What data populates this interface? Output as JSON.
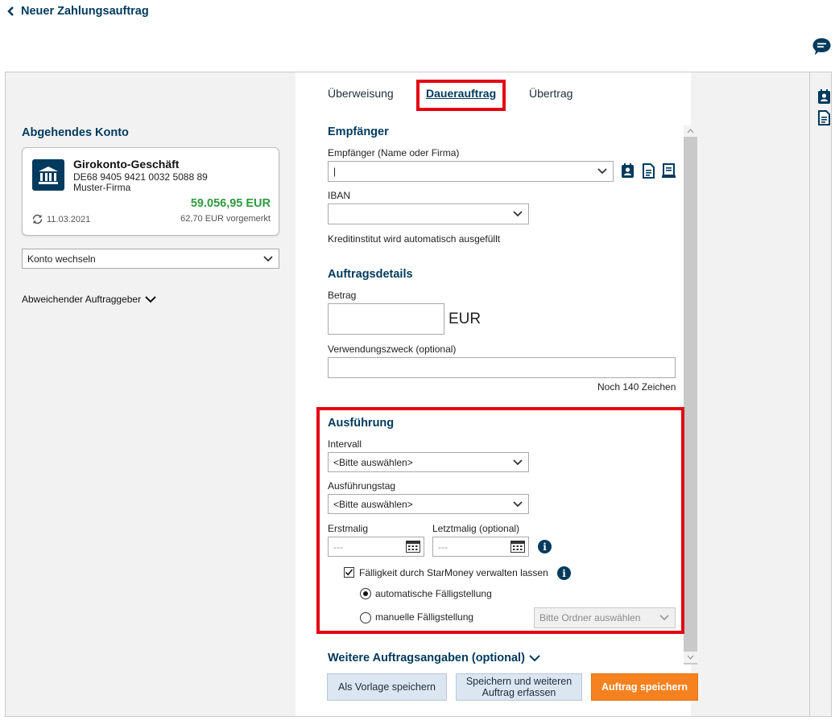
{
  "header": {
    "back_label": "Neuer Zahlungsauftrag"
  },
  "account": {
    "section_title": "Abgehendes Konto",
    "name": "Girokonto-Geschäft",
    "iban": "DE68 9405 9421 0032 5088 89",
    "holder": "Muster-Firma",
    "balance": "59.056,95 EUR",
    "date": "11.03.2021",
    "pending": "62,70 EUR vorgemerkt",
    "switch_label": "Konto wechseln",
    "other_payer_label": "Abweichender Auftraggeber"
  },
  "tabs": [
    "Überweisung",
    "Dauerauftrag",
    "Übertrag"
  ],
  "recipient": {
    "title": "Empfänger",
    "name_label": "Empfänger (Name oder Firma)",
    "name_value": "|",
    "iban_label": "IBAN",
    "bank_note": "Kreditinstitut wird automatisch ausgefüllt"
  },
  "details": {
    "title": "Auftragsdetails",
    "amount_label": "Betrag",
    "currency": "EUR",
    "purpose_label": "Verwendungszweck (optional)",
    "remaining": "Noch 140 Zeichen"
  },
  "execution": {
    "title": "Ausführung",
    "interval_label": "Intervall",
    "interval_value": "<Bitte auswählen>",
    "day_label": "Ausführungstag",
    "day_value": "<Bitte auswählen>",
    "first_label": "Erstmalig",
    "first_value": "---",
    "last_label": "Letztmalig (optional)",
    "last_value": "---",
    "manage_label": "Fälligkeit durch StarMoney verwalten lassen",
    "manage_checked": true,
    "auto_label": "automatische Fälligstellung",
    "manual_label": "manuelle Fälligstellung",
    "folder_placeholder": "Bitte Ordner auswählen"
  },
  "more": {
    "label": "Weitere Auftragsangaben (optional)"
  },
  "buttons": {
    "template": "Als Vorlage speichern",
    "save_more_line1": "Speichern und weiteren",
    "save_more_line2": "Auftrag erfassen",
    "save": "Auftrag speichern"
  },
  "colors": {
    "brand": "#003a5d",
    "balance": "#2e9a3f",
    "primary_button": "#f5821f",
    "highlight": "#e30613"
  }
}
